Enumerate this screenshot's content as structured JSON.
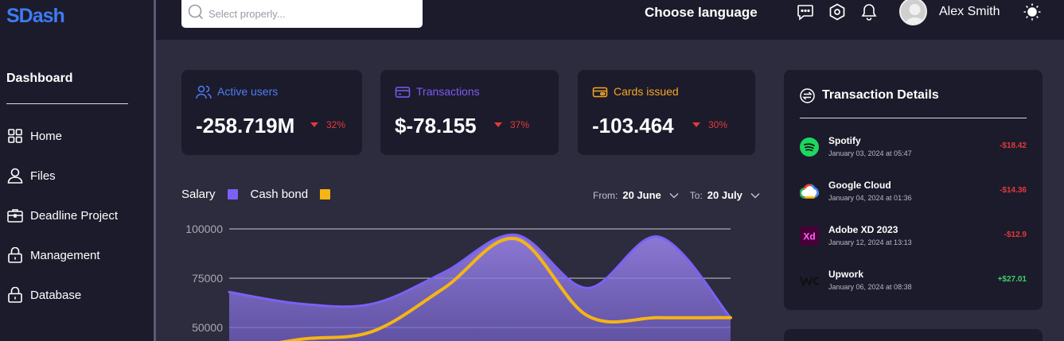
{
  "app": {
    "logo": "SDash"
  },
  "sidebar": {
    "heading": "Dashboard",
    "items": [
      {
        "label": "Home",
        "icon": "grid-icon"
      },
      {
        "label": "Files",
        "icon": "user-icon"
      },
      {
        "label": "Deadline Project",
        "icon": "briefcase-icon"
      },
      {
        "label": "Management",
        "icon": "lock-icon"
      },
      {
        "label": "Database",
        "icon": "lock-icon"
      }
    ]
  },
  "topbar": {
    "search_placeholder": "Select properly...",
    "language": "Choose language",
    "user_name": "Alex Smith"
  },
  "stats": [
    {
      "title": "Active users",
      "value": "-258.719M",
      "delta": "32%",
      "color": "#4d7cf5"
    },
    {
      "title": "Transactions",
      "value": "$-78.155",
      "delta": "37%",
      "color": "#7b5cf5"
    },
    {
      "title": "Cards issued",
      "value": "-103.464",
      "delta": "30%",
      "color": "#f5a623"
    }
  ],
  "chart_header": {
    "from_label": "From:",
    "from_value": "20 June",
    "to_label": "To:",
    "to_value": "20 July"
  },
  "chart_data": {
    "type": "area",
    "series": [
      {
        "name": "Salary",
        "color": "#7b61f5",
        "values": [
          68000,
          62000,
          62000,
          78000,
          97000,
          70000,
          96000,
          55000
        ]
      },
      {
        "name": "Cash bond",
        "color": "#f5b514",
        "values": [
          38000,
          44000,
          48000,
          70000,
          95000,
          56000,
          55000,
          55000
        ]
      }
    ],
    "yticks": [
      "100000",
      "75000",
      "50000"
    ]
  },
  "transactions": {
    "title": "Transaction Details",
    "rows": [
      {
        "name": "Spotify",
        "date": "January 03, 2024 at 05:47",
        "amount": "-$18.42",
        "color": "#e23a3a",
        "icon": "spotify-icon"
      },
      {
        "name": "Google Cloud",
        "date": "January 04, 2024 at 01:36",
        "amount": "-$14.36",
        "color": "#e23a3a",
        "icon": "google-cloud-icon"
      },
      {
        "name": "Adobe XD 2023",
        "date": "January 12, 2024 at 13:13",
        "amount": "-$12.9",
        "color": "#e23a3a",
        "icon": "adobe-xd-icon"
      },
      {
        "name": "Upwork",
        "date": "January 06, 2024 at 08:38",
        "amount": "+$27.01",
        "color": "#3fd06a",
        "icon": "upwork-icon"
      }
    ]
  }
}
